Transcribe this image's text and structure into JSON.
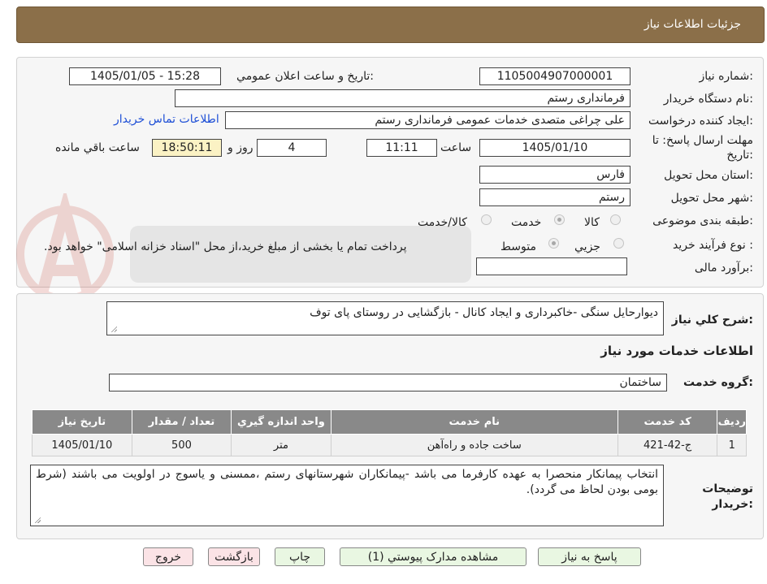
{
  "header": {
    "title": "جزئیات اطلاعات نیاز"
  },
  "form": {
    "need_number": {
      "label": "شماره نیاز:",
      "value": "1105004907000001"
    },
    "announce_datetime": {
      "label": "تاریخ و ساعت اعلان عمومي:",
      "value": "1405/01/05 - 15:28"
    },
    "buyer_org": {
      "label": "نام دستگاه خريدار:",
      "value": "فرمانداری رستم"
    },
    "creator": {
      "label": "ایجاد کننده درخواست:",
      "value": "علی چراغی متصدی خدمات عمومی فرمانداری رستم"
    },
    "buyer_contact_link": "اطلاعات تماس خريدار",
    "deadline": {
      "label_line1": "مهلت ارسال پاسخ: تا",
      "label_line2": "تاریخ:",
      "date": "1405/01/10",
      "time_label": "ساعت",
      "time": "11:11",
      "days": "4",
      "days_label": "روز و",
      "remaining": "18:50:11",
      "remaining_label": "ساعت باقي مانده"
    },
    "province": {
      "label": "استان محل تحویل:",
      "value": "فارس"
    },
    "city": {
      "label": "شهر محل تحویل:",
      "value": "رستم"
    },
    "category": {
      "label": "طبقه بندی موضوعی:",
      "options": [
        {
          "label": "کالا",
          "selected": false
        },
        {
          "label": "خدمت",
          "selected": true
        },
        {
          "label": "کالا/خدمت",
          "selected": false
        }
      ]
    },
    "purchase_process": {
      "label": "نوع فرآیند خرید :",
      "options": [
        {
          "label": "جزیي",
          "selected": false
        },
        {
          "label": "متوسط",
          "selected": true
        }
      ],
      "checkbox_text": "پرداخت تمام یا بخشی از مبلغ خرید،از محل \"اسناد خزانه اسلامی\" خواهد بود."
    },
    "budget": {
      "label": "برآورد مالی:",
      "value": ""
    }
  },
  "summary": {
    "label": "شرح کلي نياز:",
    "value": "دیوارحایل سنگی -خاکبرداری و ایجاد کانال - بازگشایی در روستای پای توف"
  },
  "services": {
    "section_title": "اطلاعات خدمات مورد نياز",
    "group_label": "گروه خدمت:",
    "group_value": "ساختمان",
    "table": {
      "headers": [
        "رديف",
        "کد خدمت",
        "نام خدمت",
        "واحد اندازه گيري",
        "تعداد / مقدار",
        "تاريخ نياز"
      ],
      "rows": [
        [
          "1",
          "ج-42-421",
          "ساخت جاده و راه‌آهن",
          "متر",
          "500",
          "1405/01/10"
        ]
      ]
    }
  },
  "buyer_notes": {
    "label_line1": "توضیحات",
    "label_line2": "خریدار:",
    "value": "انتخاب پیمانکار منحصرا به عهده کارفرما می باشد -پیمانکاران شهرستانهای رستم ،ممسنی و یاسوج در اولویت می باشند (شرط بومی بودن لحاظ می گردد)."
  },
  "buttons": {
    "reply": "پاسخ به نياز",
    "attachments": "مشاهده مدارک پیوستي (1)",
    "print": "چاپ",
    "back": "بازگشت",
    "exit": "خروج"
  },
  "colors": {
    "header_bg": "#8b6f49",
    "table_header_bg": "#898989",
    "link": "#1e4fd6",
    "button_green": "#e9f7e2",
    "button_pink": "#fbe3e6",
    "remaining_time_bg": "#fbf2c4"
  }
}
